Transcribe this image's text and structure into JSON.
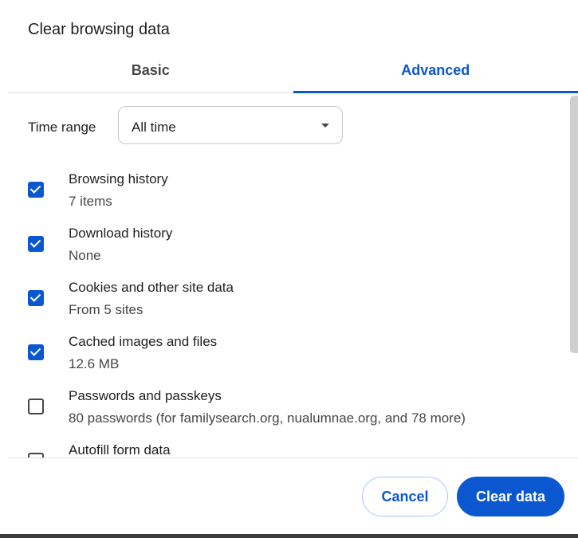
{
  "dialog": {
    "title": "Clear browsing data"
  },
  "tabs": [
    {
      "label": "Basic",
      "selected": false
    },
    {
      "label": "Advanced",
      "selected": true
    }
  ],
  "time_range": {
    "label": "Time range",
    "value": "All time"
  },
  "items": [
    {
      "title": "Browsing history",
      "detail": "7 items",
      "checked": true
    },
    {
      "title": "Download history",
      "detail": "None",
      "checked": true
    },
    {
      "title": "Cookies and other site data",
      "detail": "From 5 sites",
      "checked": true
    },
    {
      "title": "Cached images and files",
      "detail": "12.6 MB",
      "checked": true
    },
    {
      "title": "Passwords and passkeys",
      "detail": "80 passwords (for familysearch.org, nualumnae.org, and 78 more)",
      "checked": false
    },
    {
      "title": "Autofill form data",
      "detail": "",
      "checked": false
    }
  ],
  "buttons": {
    "cancel": "Cancel",
    "clear": "Clear data"
  },
  "colors": {
    "accent": "#0b57d0",
    "text": "#1f1f1f",
    "secondary_text": "#444746",
    "divider": "#e3e3e3"
  }
}
